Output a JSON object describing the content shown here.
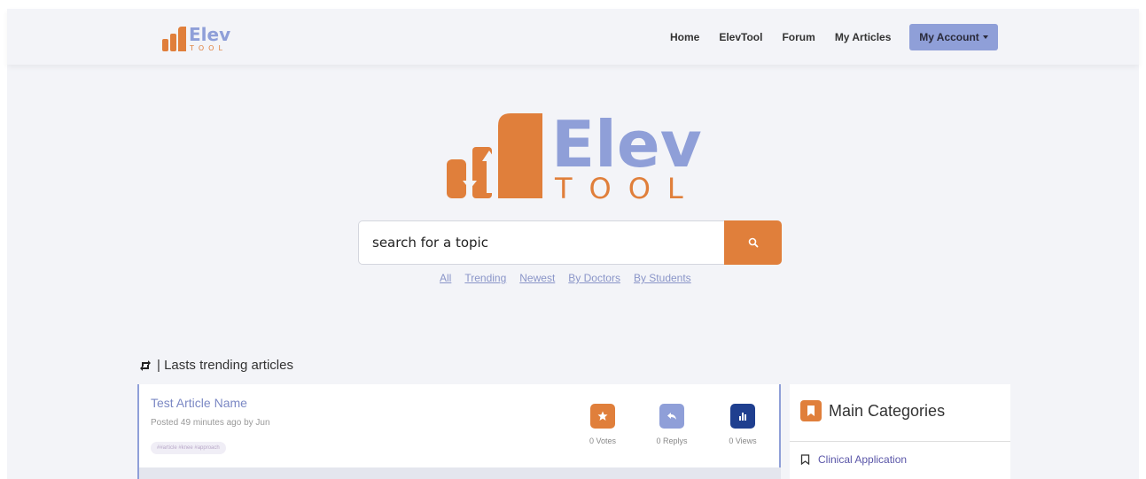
{
  "brand": {
    "name": "Elev",
    "sub": "TOOL",
    "colors": {
      "orange": "#e07f3b",
      "blue": "#8f9fd8"
    }
  },
  "nav": {
    "links": [
      "Home",
      "ElevTool",
      "Forum",
      "My Articles"
    ],
    "account_label": "My Account"
  },
  "search": {
    "placeholder": "search for a topic",
    "value": ""
  },
  "filters": [
    "All",
    "Trending",
    "Newest",
    "By Doctors",
    "By Students"
  ],
  "trending": {
    "title": "| Lasts trending articles",
    "articles": [
      {
        "title": "Test Article Name",
        "meta": "Posted 49 minutes ago by Jun",
        "tags": "##article #knee #approach",
        "votes": "0 Votes",
        "replys": "0 Replys",
        "views": "0 Views"
      }
    ]
  },
  "categories": {
    "title": "Main Categories",
    "items": [
      "Clinical Application"
    ]
  },
  "icons": [
    "star-icon",
    "reply-icon",
    "bar-chart-icon",
    "search-icon",
    "bookmark-icon",
    "retweet-icon"
  ]
}
